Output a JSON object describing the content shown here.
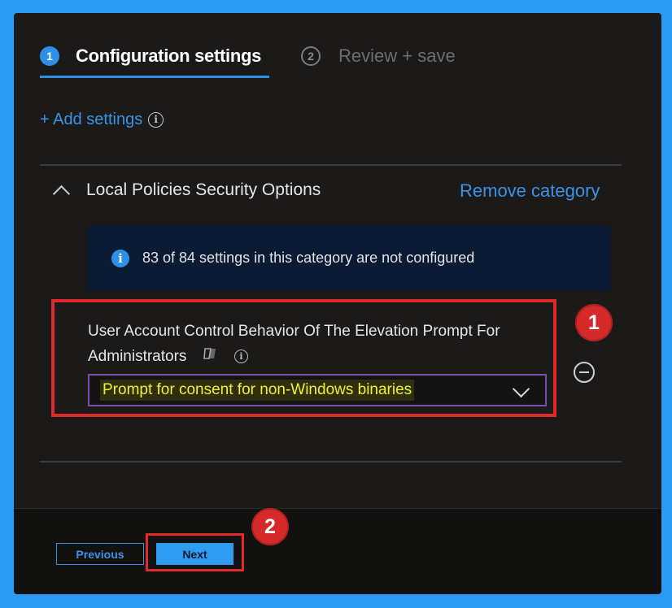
{
  "wizard": {
    "steps": [
      {
        "number": "1",
        "label": "Configuration settings",
        "active": true
      },
      {
        "number": "2",
        "label": "Review + save",
        "active": false
      }
    ]
  },
  "add_settings_label": "+ Add settings",
  "category": {
    "name": "Local Policies Security Options",
    "remove_label": "Remove category",
    "info_banner": "83 of 84 settings in this category are not configured"
  },
  "setting": {
    "label": "User Account Control Behavior Of The Elevation Prompt For Administrators",
    "selected_value": "Prompt for consent for non-Windows binaries"
  },
  "annotations": {
    "badge1": "1",
    "badge2": "2",
    "highlight_color": "#e02a2a"
  },
  "footer": {
    "previous_label": "Previous",
    "next_label": "Next"
  },
  "colors": {
    "accent": "#2e8fe6",
    "link": "#3a92e8",
    "background": "#1b1a19",
    "frame": "#2b9af3"
  }
}
